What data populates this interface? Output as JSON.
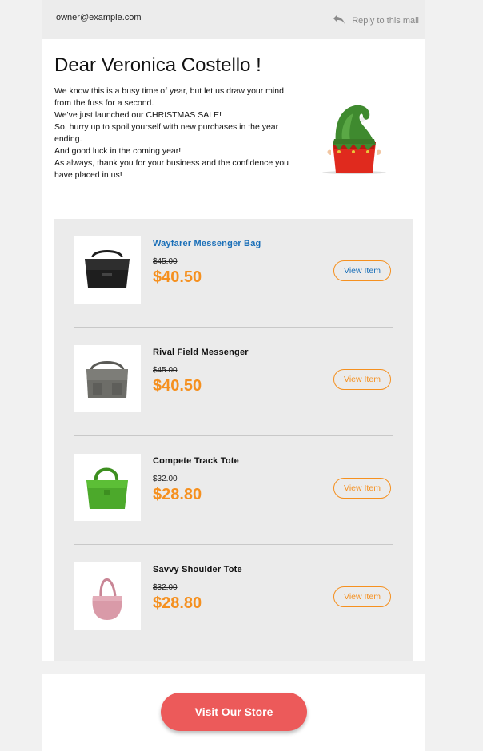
{
  "header": {
    "sender": "owner@example.com",
    "reply_label": "Reply to this mail"
  },
  "greeting": "Dear Veronica Costello !",
  "intro_lines": [
    "We know this is a busy time of year, but let us draw your mind",
    "from the fuss for a second.",
    "We've just launched our CHRISTMAS SALE!",
    "So, hurry up to spoil yourself with new purchases in the year",
    "ending.",
    "And good luck in the coming year!",
    "As always, thank you for your business and the confidence you",
    "have placed in us!"
  ],
  "decor_icon": "elf-hat-icon",
  "products": [
    {
      "name": "Wayfarer Messenger Bag",
      "old_price": "$45.00",
      "price": "$40.50",
      "button": "View Item",
      "image_icon": "messenger-bag-icon",
      "image_color": "#1e1e1e"
    },
    {
      "name": "Rival Field Messenger",
      "old_price": "$45.00",
      "price": "$40.50",
      "button": "View Item",
      "image_icon": "messenger-bag-icon",
      "image_color": "#6d6d68"
    },
    {
      "name": "Compete Track Tote",
      "old_price": "$32.00",
      "price": "$28.80",
      "button": "View Item",
      "image_icon": "tote-bag-icon",
      "image_color": "#4ca92b"
    },
    {
      "name": "Savvy Shoulder Tote",
      "old_price": "$32.00",
      "price": "$28.80",
      "button": "View Item",
      "image_icon": "shoulder-bag-icon",
      "image_color": "#d99aa8"
    }
  ],
  "colors": {
    "accent_orange": "#f5901f",
    "link_blue": "#1a6fb8",
    "cta_red": "#ec5a5a"
  },
  "cta": {
    "label": "Visit Our Store"
  }
}
